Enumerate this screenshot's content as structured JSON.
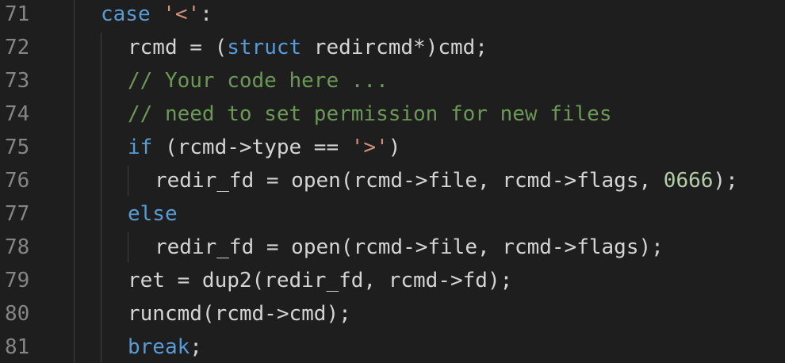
{
  "editor": {
    "lines": [
      {
        "num": "71",
        "indent": 0,
        "tokens": [
          {
            "t": "case",
            "c": "kw"
          },
          {
            "t": " ",
            "c": ""
          },
          {
            "t": "'<'",
            "c": "str"
          },
          {
            "t": ":",
            "c": ""
          }
        ]
      },
      {
        "num": "72",
        "indent": 1,
        "tokens": [
          {
            "t": "rcmd = (",
            "c": ""
          },
          {
            "t": "struct",
            "c": "kw"
          },
          {
            "t": " redircmd*)cmd;",
            "c": ""
          }
        ]
      },
      {
        "num": "73",
        "indent": 1,
        "tokens": [
          {
            "t": "// Your code here ...",
            "c": "cm"
          }
        ]
      },
      {
        "num": "74",
        "indent": 1,
        "tokens": [
          {
            "t": "// need to set permission for new files",
            "c": "cm"
          }
        ]
      },
      {
        "num": "75",
        "indent": 1,
        "tokens": [
          {
            "t": "if",
            "c": "kw"
          },
          {
            "t": " (rcmd->type == ",
            "c": ""
          },
          {
            "t": "'>'",
            "c": "str"
          },
          {
            "t": ")",
            "c": ""
          }
        ]
      },
      {
        "num": "76",
        "indent": 2,
        "tokens": [
          {
            "t": "redir_fd = open(rcmd->file, rcmd->flags, ",
            "c": ""
          },
          {
            "t": "0666",
            "c": "num"
          },
          {
            "t": ");",
            "c": ""
          }
        ]
      },
      {
        "num": "77",
        "indent": 1,
        "tokens": [
          {
            "t": "else",
            "c": "kw"
          }
        ]
      },
      {
        "num": "78",
        "indent": 2,
        "tokens": [
          {
            "t": "redir_fd = open(rcmd->file, rcmd->flags);",
            "c": ""
          }
        ]
      },
      {
        "num": "79",
        "indent": 1,
        "tokens": [
          {
            "t": "ret = dup2(redir_fd, rcmd->fd);",
            "c": ""
          }
        ]
      },
      {
        "num": "80",
        "indent": 1,
        "tokens": [
          {
            "t": "runcmd(rcmd->cmd);",
            "c": ""
          }
        ]
      },
      {
        "num": "81",
        "indent": 1,
        "tokens": [
          {
            "t": "break",
            "c": "kw"
          },
          {
            "t": ";",
            "c": ""
          }
        ]
      }
    ],
    "colors": {
      "background": "#1e1e1e",
      "keyword": "#569cd6",
      "string": "#ce9178",
      "comment": "#6a9955",
      "number": "#b5cea8",
      "text": "#d4d4d4",
      "line_number": "#858585"
    }
  }
}
